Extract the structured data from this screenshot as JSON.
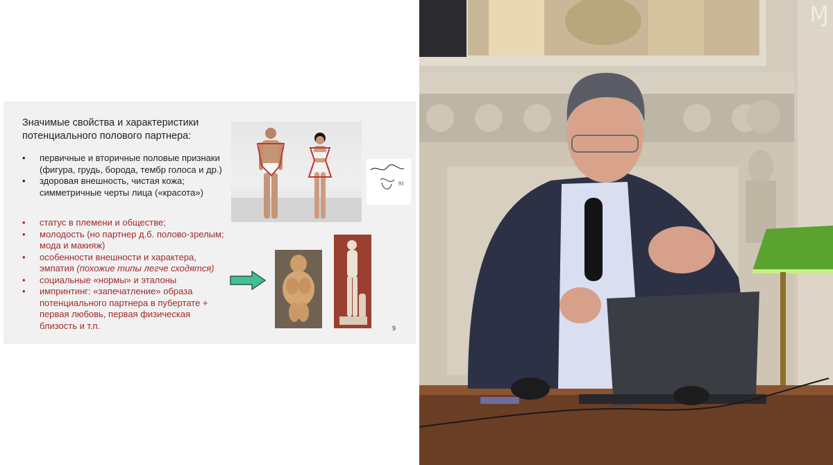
{
  "slide": {
    "title": "Значимые свойства и характеристики потенциального полового партнера:",
    "bullets_black": [
      "первичные и вторичные половые признаки (фигура, грудь, борода, тембр голоса и др.)",
      "здоровая внешность, чистая кожа; симметричные черты лица («красота»)"
    ],
    "bullets_red": [
      {
        "text": "статус в племени и обществе;"
      },
      {
        "text": "молодость (но партнер д.б. полово-зрелым; мода и макияж)"
      },
      {
        "text": "особенности внешности и характера, эмпатия ",
        "em": "(похожие типы легче сходятся)"
      },
      {
        "text": "социальные «нормы» и эталоны"
      },
      {
        "text": "импринтинг: «запечатление» образа потенциального партнера в пубертате + первая любовь, первая физическая близость и т.п."
      }
    ],
    "page_number": "9",
    "signature_text": "91",
    "bullet_char": "•"
  },
  "video": {
    "logo": "Ɱ"
  },
  "colors": {
    "red_text": "#a12a2a",
    "arrow_fill": "#3fbf93",
    "arrow_stroke": "#2e5a4d",
    "slide_bg": "#f1f1f1"
  }
}
